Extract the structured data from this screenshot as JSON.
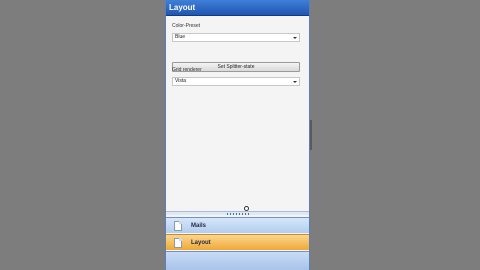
{
  "panel": {
    "title": "Layout"
  },
  "settings": {
    "color_preset_label": "Color-Preset",
    "color_preset_value": "Blue",
    "splitter_button_label": "Set Splitter-state",
    "grid_renderer_label": "Grid renderer",
    "grid_renderer_value": "Vista"
  },
  "navigation": {
    "items": [
      {
        "label": "Mails",
        "icon": "document-icon",
        "selected": false
      },
      {
        "label": "Layout",
        "icon": "document-icon",
        "selected": true
      }
    ]
  },
  "colors": {
    "title_bar": "#2a66c4",
    "selected_item": "#f5b84a",
    "nav_item": "#c4d9f5"
  }
}
